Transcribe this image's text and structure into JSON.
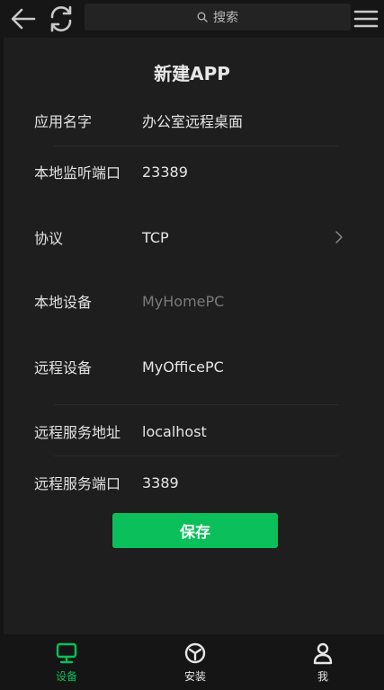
{
  "topbar": {
    "search_placeholder": "搜索",
    "icons": [
      "back-arrow-icon",
      "refresh-icon",
      "search-icon",
      "hamburger-menu-icon"
    ]
  },
  "page": {
    "title": "新建APP"
  },
  "form": {
    "app_name": {
      "label": "应用名字",
      "value": "办公室远程桌面"
    },
    "local_port": {
      "label": "本地监听端口",
      "value": "23389"
    },
    "protocol": {
      "label": "协议",
      "value": "TCP"
    },
    "local_device": {
      "label": "本地设备",
      "value": "MyHomePC"
    },
    "remote_device": {
      "label": "远程设备",
      "value": "MyOfficePC"
    },
    "remote_address": {
      "label": "远程服务地址",
      "value": "localhost"
    },
    "remote_port": {
      "label": "远程服务端口",
      "value": "3389"
    }
  },
  "actions": {
    "save_label": "保存"
  },
  "bottom_nav": {
    "items": [
      {
        "label": "设备",
        "icon": "monitor-icon",
        "active": true
      },
      {
        "label": "安装",
        "icon": "install-icon",
        "active": false
      },
      {
        "label": "我",
        "icon": "person-icon",
        "active": false
      }
    ]
  },
  "colors": {
    "accent": "#0bbf5a",
    "background": "#1e1e1e",
    "topbar": "#161616",
    "placeholder_text": "#7a7a7a"
  }
}
